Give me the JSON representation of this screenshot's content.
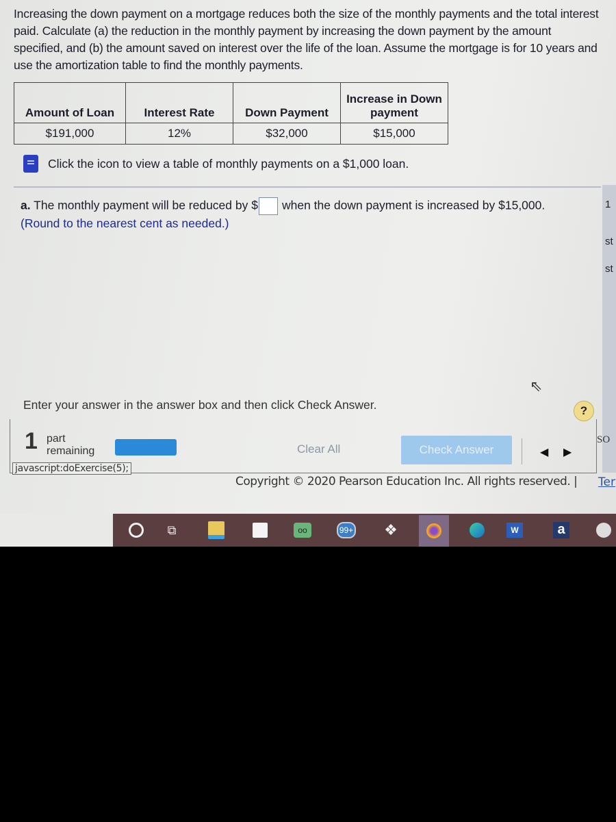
{
  "problem": {
    "intro": "Increasing the down payment on a mortgage reduces both the size of the monthly payments and the total interest paid. Calculate (a) the reduction in the monthly payment by increasing the down payment by the amount specified, and (b) the amount saved on interest over the life of the loan. Assume the mortgage is for 10 years and use the amortization table to find the monthly payments.",
    "table": {
      "headers": [
        "Amount of Loan",
        "Interest Rate",
        "Down Payment",
        "Increase in Down payment"
      ],
      "row": [
        "$191,000",
        "12%",
        "$32,000",
        "$15,000"
      ]
    },
    "hint": "Click the icon to view a table of monthly payments on a $1,000 loan."
  },
  "question": {
    "label": "a.",
    "text_before": "The monthly payment will be reduced by $",
    "answer_value": "",
    "text_after": "when the down payment is increased by $15,000.",
    "rounding_note": "(Round to the nearest cent as needed.)"
  },
  "side_text": [
    "1",
    "st",
    "st"
  ],
  "footer": {
    "instruction": "Enter your answer in the answer box and then click Check Answer.",
    "help_label": "?",
    "parts_number": "1",
    "parts_label_1": "part",
    "parts_label_2": "remaining",
    "progress_fraction": 1.0,
    "clear_all": "Clear All",
    "check_answer": "Check Answer",
    "prev": "◀",
    "next": "▶",
    "status_link": "javascript:doExercise(5);",
    "edge_text": "SO",
    "copyright": "Copyright © 2020 Pearson Education Inc. All rights reserved. |",
    "terms": "Ter"
  },
  "taskbar": {
    "items": [
      "cortana",
      "task-view",
      "file-explorer",
      "store",
      "tripadvisor",
      "mail",
      "dropbox",
      "firefox",
      "edge",
      "word",
      "amazon",
      "itunes"
    ],
    "mail_badge": "99+"
  }
}
